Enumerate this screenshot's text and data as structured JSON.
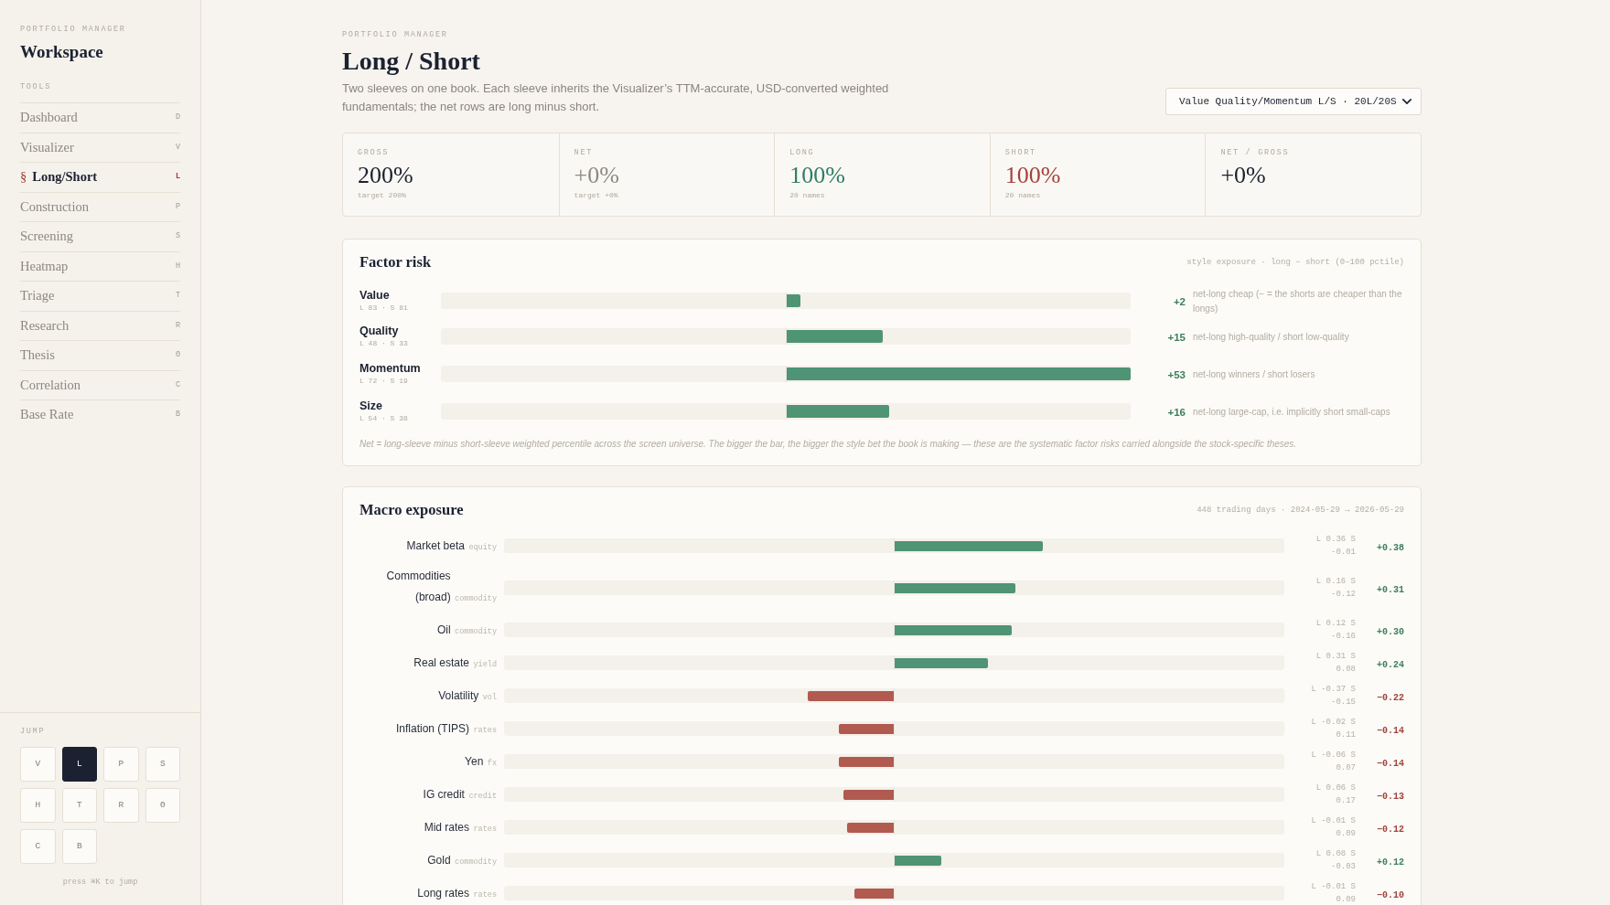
{
  "sidebar": {
    "eyebrow": "PORTFOLIO MANAGER",
    "title": "Workspace",
    "section_label": "TOOLS",
    "selected_marker": "§",
    "nav": [
      {
        "label": "Dashboard",
        "shortcut": "D",
        "selected": false
      },
      {
        "label": "Visualizer",
        "shortcut": "V",
        "selected": false
      },
      {
        "label": "Long/Short",
        "shortcut": "L",
        "selected": true
      },
      {
        "label": "Construction",
        "shortcut": "P",
        "selected": false
      },
      {
        "label": "Screening",
        "shortcut": "S",
        "selected": false
      },
      {
        "label": "Heatmap",
        "shortcut": "H",
        "selected": false
      },
      {
        "label": "Triage",
        "shortcut": "T",
        "selected": false
      },
      {
        "label": "Research",
        "shortcut": "R",
        "selected": false
      },
      {
        "label": "Thesis",
        "shortcut": "Θ",
        "selected": false
      },
      {
        "label": "Correlation",
        "shortcut": "C",
        "selected": false
      },
      {
        "label": "Base Rate",
        "shortcut": "B",
        "selected": false
      }
    ],
    "jump": {
      "label": "JUMP",
      "keys": [
        {
          "key": "V",
          "selected": false
        },
        {
          "key": "L",
          "selected": true
        },
        {
          "key": "P",
          "selected": false
        },
        {
          "key": "S",
          "selected": false
        },
        {
          "key": "H",
          "selected": false
        },
        {
          "key": "T",
          "selected": false
        },
        {
          "key": "R",
          "selected": false
        },
        {
          "key": "Θ",
          "selected": false
        },
        {
          "key": "C",
          "selected": false
        },
        {
          "key": "B",
          "selected": false
        }
      ],
      "hint": "press ⌘K to jump"
    }
  },
  "header": {
    "eyebrow": "PORTFOLIO MANAGER",
    "title": "Long / Short",
    "description": "Two sleeves on one book. Each sleeve inherits the Visualizer’s TTM-accurate, USD-converted weighted fundamentals; the net rows are long minus short.",
    "book_select": {
      "value": "Value Quality/Momentum L/S · 20L/20S"
    }
  },
  "stats": [
    {
      "label": "GROSS",
      "value": "200%",
      "sub": "target 200%",
      "color": "#1b2130"
    },
    {
      "label": "NET",
      "value": "+0%",
      "sub": "target +0%",
      "color": "#8f8983"
    },
    {
      "label": "LONG",
      "value": "100%",
      "sub": "20 names",
      "color": "#2e7d68"
    },
    {
      "label": "SHORT",
      "value": "100%",
      "sub": "20 names",
      "color": "#a2443a"
    },
    {
      "label": "NET / GROSS",
      "value": "+0%",
      "color": "#1b2130"
    }
  ],
  "factor_risk": {
    "title": "Factor risk",
    "caption": "style exposure · long − short (0–100 pctile)",
    "rows": [
      {
        "name": "Value",
        "sleeves": "L 83 · S 81",
        "kind": "positive",
        "level": 0.04,
        "net": "+2",
        "note": "net-long cheap (− = the shorts are cheaper than the longs)"
      },
      {
        "name": "Quality",
        "sleeves": "L 48 · S 33",
        "kind": "positive",
        "level": 0.28,
        "net": "+15",
        "note": "net-long high-quality / short low-quality"
      },
      {
        "name": "Momentum",
        "sleeves": "L 72 · S 19",
        "kind": "positive",
        "level": 1.0,
        "net": "+53",
        "note": "net-long winners / short losers"
      },
      {
        "name": "Size",
        "sleeves": "L 54 · S 38",
        "kind": "positive",
        "level": 0.3,
        "net": "+16",
        "note": "net-long large-cap, i.e. implicitly short small-caps"
      }
    ],
    "footnote": "Net = long-sleeve minus short-sleeve weighted percentile across the screen universe. The bigger the bar, the bigger the style bet the book is making — these are the systematic factor risks carried alongside the stock-specific theses."
  },
  "macro_exposure": {
    "title": "Macro exposure",
    "caption": "448 trading days · 2024-05-29 → 2026-05-29",
    "rows": [
      {
        "name": "Market beta",
        "asset_class": "equity",
        "kind": "positive",
        "level": 0.38,
        "sleeves": "L 0.36 S -0.01",
        "net": "+0.38"
      },
      {
        "name": "Commodities (broad)",
        "asset_class": "commodity",
        "kind": "positive",
        "level": 0.31,
        "sleeves": "L 0.16 S -0.12",
        "net": "+0.31"
      },
      {
        "name": "Oil",
        "asset_class": "commodity",
        "kind": "positive",
        "level": 0.3,
        "sleeves": "L 0.12 S -0.16",
        "net": "+0.30"
      },
      {
        "name": "Real estate",
        "asset_class": "yield",
        "kind": "positive",
        "level": 0.24,
        "sleeves": "L 0.31 S 0.08",
        "net": "+0.24"
      },
      {
        "name": "Volatility",
        "asset_class": "vol",
        "kind": "negative",
        "level": 0.22,
        "sleeves": "L -0.37 S -0.15",
        "net": "−0.22"
      },
      {
        "name": "Inflation (TIPS)",
        "asset_class": "rates",
        "kind": "negative",
        "level": 0.14,
        "sleeves": "L -0.02 S 0.11",
        "net": "−0.14"
      },
      {
        "name": "Yen",
        "asset_class": "fx",
        "kind": "negative",
        "level": 0.14,
        "sleeves": "L -0.06 S 0.07",
        "net": "−0.14"
      },
      {
        "name": "IG credit",
        "asset_class": "credit",
        "kind": "negative",
        "level": 0.13,
        "sleeves": "L 0.06 S 0.17",
        "net": "−0.13"
      },
      {
        "name": "Mid rates",
        "asset_class": "rates",
        "kind": "negative",
        "level": 0.12,
        "sleeves": "L -0.01 S 0.09",
        "net": "−0.12"
      },
      {
        "name": "Gold",
        "asset_class": "commodity",
        "kind": "positive",
        "level": 0.12,
        "sleeves": "L 0.08 S -0.03",
        "net": "+0.12"
      },
      {
        "name": "Long rates",
        "asset_class": "rates",
        "kind": "negative",
        "level": 0.1,
        "sleeves": "L -0.01 S 0.09",
        "net": "−0.10"
      }
    ]
  }
}
